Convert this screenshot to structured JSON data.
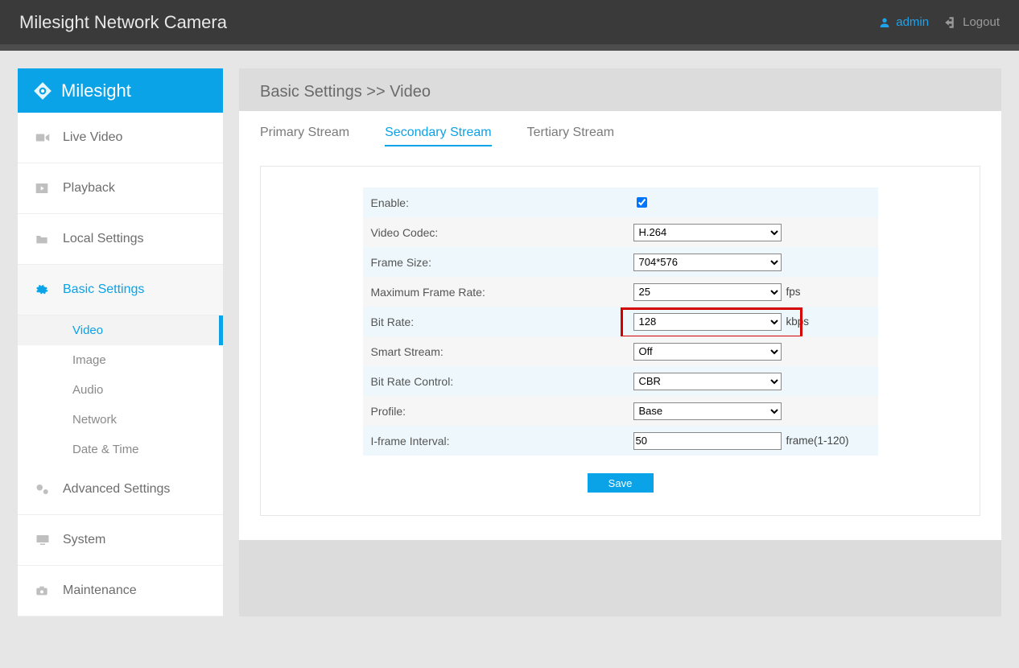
{
  "header": {
    "title": "Milesight Network Camera",
    "user": "admin",
    "logout": "Logout"
  },
  "brand": {
    "name": "Milesight"
  },
  "sidebar": {
    "items": [
      {
        "id": "live",
        "label": "Live Video"
      },
      {
        "id": "playback",
        "label": "Playback"
      },
      {
        "id": "local",
        "label": "Local Settings"
      },
      {
        "id": "basic",
        "label": "Basic Settings"
      },
      {
        "id": "advanced",
        "label": "Advanced Settings"
      },
      {
        "id": "system",
        "label": "System"
      },
      {
        "id": "maint",
        "label": "Maintenance"
      }
    ],
    "basic_sub": [
      {
        "id": "video",
        "label": "Video"
      },
      {
        "id": "image",
        "label": "Image"
      },
      {
        "id": "audio",
        "label": "Audio"
      },
      {
        "id": "network",
        "label": "Network"
      },
      {
        "id": "date",
        "label": "Date & Time"
      }
    ]
  },
  "breadcrumb": "Basic Settings >> Video",
  "tabs": {
    "primary": "Primary Stream",
    "secondary": "Secondary Stream",
    "tertiary": "Tertiary Stream"
  },
  "form": {
    "enable": {
      "label": "Enable:",
      "checked": true
    },
    "codec": {
      "label": "Video Codec:",
      "value": "H.264"
    },
    "frame_size": {
      "label": "Frame Size:",
      "value": "704*576"
    },
    "frame_rate": {
      "label": "Maximum Frame Rate:",
      "value": "25",
      "unit": "fps"
    },
    "bit_rate": {
      "label": "Bit Rate:",
      "value": "128",
      "unit": "kbps"
    },
    "smart_stream": {
      "label": "Smart Stream:",
      "value": "Off"
    },
    "brc": {
      "label": "Bit Rate Control:",
      "value": "CBR"
    },
    "profile": {
      "label": "Profile:",
      "value": "Base"
    },
    "iframe": {
      "label": "I-frame Interval:",
      "value": "50",
      "unit": "frame(1-120)"
    }
  },
  "buttons": {
    "save": "Save"
  }
}
